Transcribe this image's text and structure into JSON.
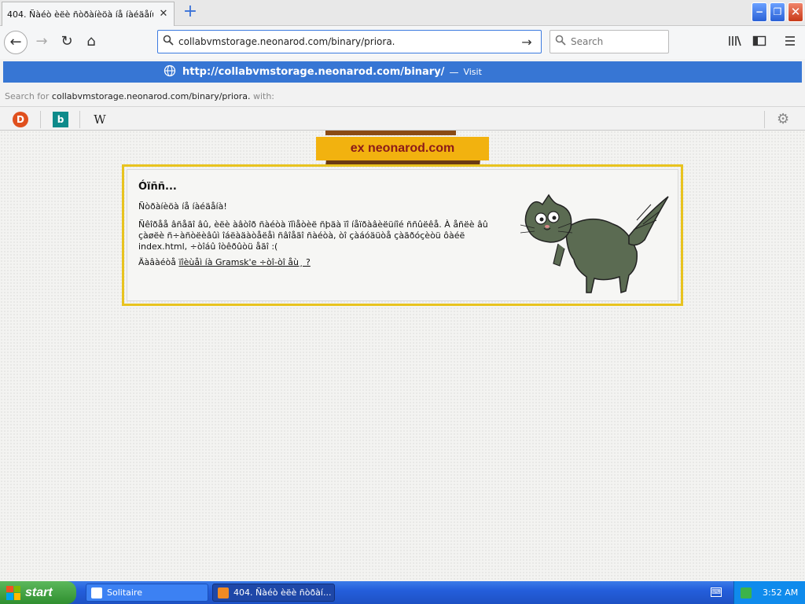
{
  "browser": {
    "tab": {
      "title": "404. Ñàéò èëè ñòðàíèöà íå íàéäåíû íà ñ"
    },
    "window_controls": {
      "minimize": "−",
      "maximize": "❐",
      "close": "✕"
    },
    "nav": {
      "url": "collabvmstorage.neonarod.com/binary/priora.",
      "search_placeholder": "Search"
    },
    "dropdown": {
      "visit_url": "http://collabvmstorage.neonarod.com/binary/",
      "visit_sep": "—",
      "visit_label": "Visit",
      "search_for_label": "Search for",
      "search_for_query": "collabvmstorage.neonarod.com/binary/priora.",
      "search_with_label": "with:",
      "engines": [
        "DuckDuckGo",
        "Bing",
        "Wikipedia"
      ],
      "engine_glyphs": {
        "ddg": "D",
        "bing": "b",
        "wiki": "W"
      }
    }
  },
  "page": {
    "logo_text": "ex neonarod.com",
    "error": {
      "title": "Óïññ...",
      "subtitle": "Ñòðàíèöà íå íàéäåíà!",
      "body": "Ñêîðåå âñåãî âû, èëè àâòîð ñàéòà ïîìåòèë ñþäà ïî íåïðàâèëüíîé ññûëêå. À åñëè âû çàøëè ñ÷àñòëèâûì îáëàäàòåëåì ñâîåãî ñàéòà, òî çàáóäüòå çàãðóçèòü ôàéë index.html, ÷òîáû îòêðûòü åãî :(",
      "back_prefix": "Äàâàéòå",
      "back_link": "ïîèùåì íà Gramsk'e ÷òî-òî åù¸ ?"
    }
  },
  "taskbar": {
    "start_label": "start",
    "tasks": [
      {
        "label": "Solitaire"
      },
      {
        "label": "404. Ñàéò èëè ñòðàí..."
      }
    ],
    "clock": "3:52 AM"
  },
  "colors": {
    "accent": "#3776d4",
    "logo_yellow": "#f2b20f",
    "box_border": "#e8c31e",
    "taskbar_blue": "#245edb"
  }
}
